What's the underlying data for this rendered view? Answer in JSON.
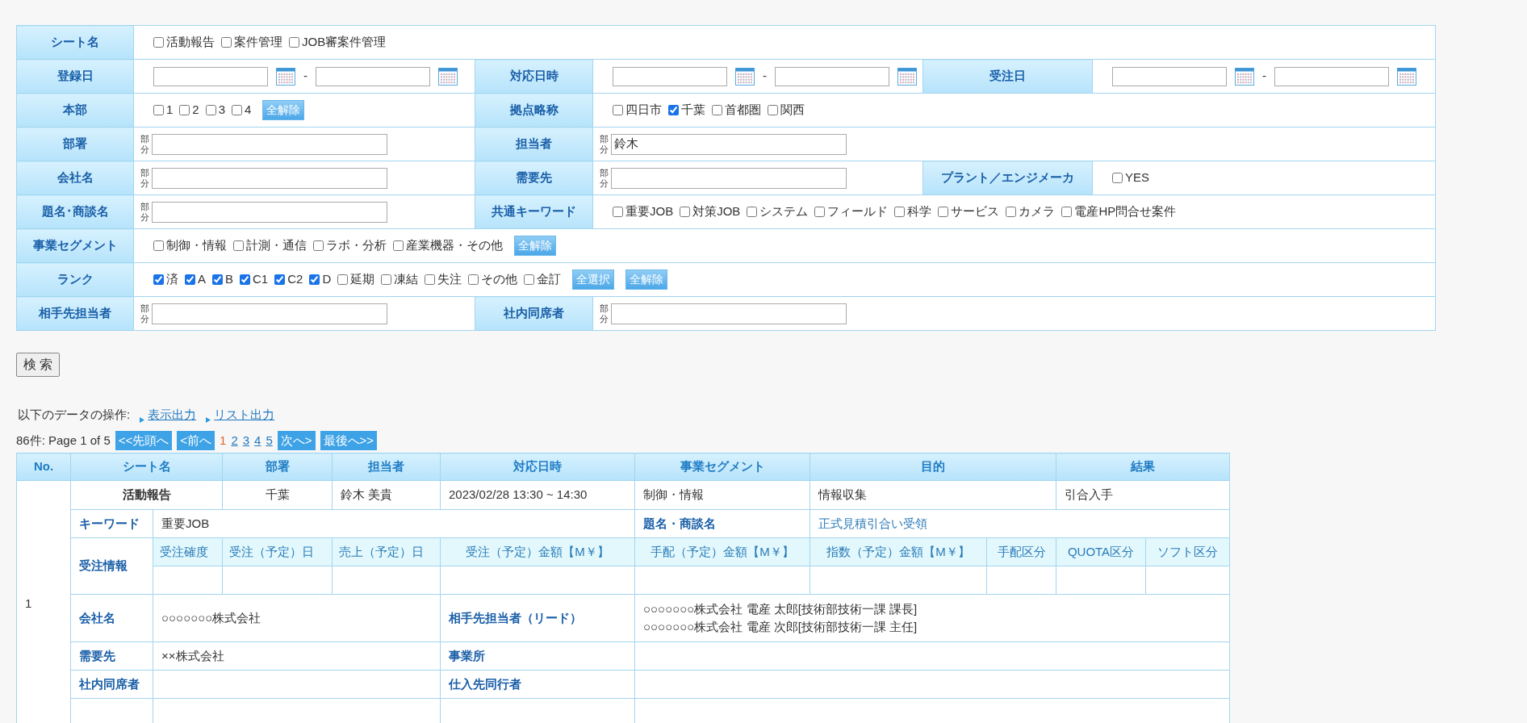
{
  "search_form": {
    "rows": [
      {
        "cells": [
          {
            "label": "シート名",
            "kind": "checks",
            "options": [
              {
                "label": "活動報告",
                "checked": false
              },
              {
                "label": "案件管理",
                "checked": false
              },
              {
                "label": "JOB審案件管理",
                "checked": false
              }
            ]
          }
        ]
      },
      {
        "cells": [
          {
            "label": "登録日",
            "kind": "date_range",
            "separator": "-"
          },
          {
            "label": "対応日時",
            "kind": "date_range",
            "separator": "-"
          },
          {
            "label": "受注日",
            "kind": "date_range",
            "separator": "-"
          }
        ]
      },
      {
        "cells": [
          {
            "label": "本部",
            "kind": "checks",
            "options": [
              {
                "label": "1",
                "checked": false
              },
              {
                "label": "2",
                "checked": false
              },
              {
                "label": "3",
                "checked": false
              },
              {
                "label": "4",
                "checked": false
              }
            ],
            "buttons": [
              "全解除"
            ]
          },
          {
            "label": "拠点略称",
            "kind": "checks",
            "options": [
              {
                "label": "四日市",
                "checked": false
              },
              {
                "label": "千葉",
                "checked": true
              },
              {
                "label": "首都圏",
                "checked": false
              },
              {
                "label": "関西",
                "checked": false
              }
            ]
          }
        ]
      },
      {
        "cells": [
          {
            "label": "部署",
            "kind": "text",
            "mode": "部分"
          },
          {
            "label": "担当者",
            "kind": "text",
            "mode": "部分",
            "value": "鈴木"
          }
        ]
      },
      {
        "cells": [
          {
            "label": "会社名",
            "kind": "text",
            "mode": "部分"
          },
          {
            "label": "需要先",
            "kind": "text",
            "mode": "部分"
          },
          {
            "label": "プラント／エンジメーカ",
            "kind": "checks",
            "options": [
              {
                "label": "YES",
                "checked": false
              }
            ]
          }
        ]
      },
      {
        "cells": [
          {
            "label": "題名･商談名",
            "kind": "text",
            "mode": "部分"
          },
          {
            "label": "共通キーワード",
            "kind": "checks",
            "options": [
              {
                "label": "重要JOB",
                "checked": false
              },
              {
                "label": "対策JOB",
                "checked": false
              },
              {
                "label": "システム",
                "checked": false
              },
              {
                "label": "フィールド",
                "checked": false
              },
              {
                "label": "科学",
                "checked": false
              },
              {
                "label": "サービス",
                "checked": false
              },
              {
                "label": "カメラ",
                "checked": false
              },
              {
                "label": "電産HP問合せ案件",
                "checked": false
              }
            ]
          }
        ]
      },
      {
        "cells": [
          {
            "label": "事業セグメント",
            "kind": "checks",
            "options": [
              {
                "label": "制御・情報",
                "checked": false
              },
              {
                "label": "計測・通信",
                "checked": false
              },
              {
                "label": "ラボ・分析",
                "checked": false
              },
              {
                "label": "産業機器・その他",
                "checked": false
              }
            ],
            "buttons": [
              "全解除"
            ]
          }
        ]
      },
      {
        "cells": [
          {
            "label": "ランク",
            "kind": "checks",
            "options": [
              {
                "label": "済",
                "checked": true
              },
              {
                "label": "A",
                "checked": true
              },
              {
                "label": "B",
                "checked": true
              },
              {
                "label": "C1",
                "checked": true
              },
              {
                "label": "C2",
                "checked": true
              },
              {
                "label": "D",
                "checked": true
              },
              {
                "label": "延期",
                "checked": false
              },
              {
                "label": "凍結",
                "checked": false
              },
              {
                "label": "失注",
                "checked": false
              },
              {
                "label": "その他",
                "checked": false
              },
              {
                "label": "金訂",
                "checked": false
              }
            ],
            "buttons": [
              "全選択",
              "全解除"
            ]
          }
        ]
      },
      {
        "cells": [
          {
            "label": "相手先担当者",
            "kind": "text",
            "mode": "部分"
          },
          {
            "label": "社内同席者",
            "kind": "text",
            "mode": "部分"
          }
        ]
      }
    ]
  },
  "search_button": "検 索",
  "operations": {
    "label": "以下のデータの操作:",
    "links": [
      "表示出力",
      "リスト出力"
    ]
  },
  "pagination": {
    "summary": "86件: Page 1 of 5",
    "first": "<<先頭へ",
    "prev": "<前へ",
    "pages": [
      {
        "label": "1",
        "selected": true
      },
      {
        "label": "2",
        "selected": false
      },
      {
        "label": "3",
        "selected": false
      },
      {
        "label": "4",
        "selected": false
      },
      {
        "label": "5",
        "selected": false
      }
    ],
    "next": "次へ>",
    "last": "最後へ>>"
  },
  "results": {
    "columns": [
      "No.",
      "シート名",
      "部署",
      "担当者",
      "対応日時",
      "事業セグメント",
      "目的",
      "結果"
    ],
    "records": [
      {
        "no": "1",
        "sheet": "活動報告",
        "department": "千葉",
        "person": "鈴木 美貴",
        "datetime": "2023/02/28 13:30 ~ 14:30",
        "segment": "制御・情報",
        "purpose": "情報収集",
        "result": "引合入手",
        "keyword_label": "キーワード",
        "keyword": "重要JOB",
        "title_label": "題名・商談名",
        "title": "正式見積引合い受領",
        "order_label": "受注情報",
        "order_columns": [
          "受注確度",
          "受注（予定）日",
          "売上（予定）日",
          "受注（予定）金額【M￥】",
          "手配（予定）金額【M￥】",
          "指数（予定）金額【M￥】",
          "手配区分",
          "QUOTA区分",
          "ソフト区分"
        ],
        "detail_rows": [
          {
            "left": {
              "label": "会社名",
              "value": "○○○○○○○株式会社"
            },
            "right": {
              "label": "相手先担当者（リード）",
              "lines": [
                "○○○○○○○株式会社 電産 太郎[技術部技術一課 課長]",
                "○○○○○○○株式会社 電産 次郎[技術部技術一課 主任]"
              ]
            }
          },
          {
            "left": {
              "label": "需要先",
              "value": "××株式会社"
            },
            "right": {
              "label": "事業所"
            }
          },
          {
            "left": {
              "label": "社内同席者"
            },
            "right": {
              "label": "仕入先同行者"
            }
          }
        ]
      }
    ]
  }
}
